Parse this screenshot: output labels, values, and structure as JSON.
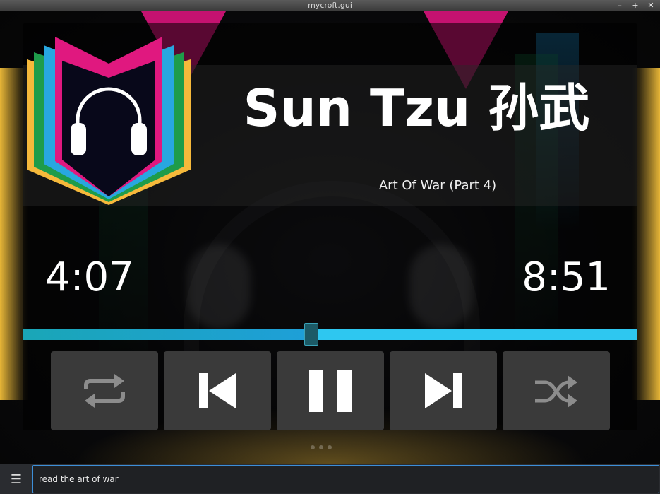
{
  "window": {
    "title": "mycroft.gui",
    "minimize_glyph": "–",
    "maximize_glyph": "+",
    "close_glyph": "✕"
  },
  "player": {
    "artist": "Sun Tzu 孙武",
    "track": "Art Of War (Part 4)",
    "current_time": "4:07",
    "total_time": "8:51",
    "progress": 0.47,
    "buttons": [
      {
        "icon": "repeat-icon",
        "label": "Repeat"
      },
      {
        "icon": "previous-icon",
        "label": "Previous"
      },
      {
        "icon": "pause-icon",
        "label": "Pause"
      },
      {
        "icon": "next-icon",
        "label": "Next"
      },
      {
        "icon": "shuffle-icon",
        "label": "Shuffle"
      }
    ]
  },
  "bottombar": {
    "menu_glyph": "☰",
    "utterance": "read the art of war"
  },
  "colors": {
    "progress_remaining": "#2ec7f0",
    "progress_played": "#1aa6b7",
    "button_bg": "#3a3a3a",
    "input_border": "#3d8fd8"
  }
}
